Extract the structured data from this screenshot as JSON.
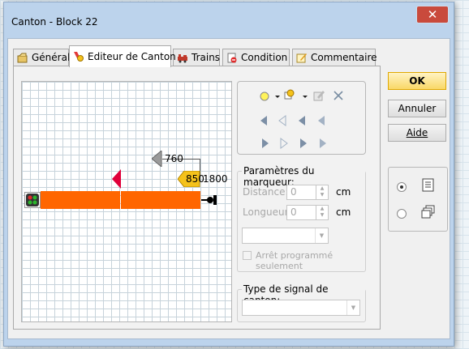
{
  "window": {
    "title": "Canton - Block 22"
  },
  "tabs": [
    {
      "label": "Général",
      "icon": "general-icon"
    },
    {
      "label": "Editeur de Canton",
      "icon": "editor-icon"
    },
    {
      "label": "Trains",
      "icon": "train-icon"
    },
    {
      "label": "Condition",
      "icon": "condition-icon"
    },
    {
      "label": "Commentaire",
      "icon": "comment-icon"
    }
  ],
  "editor": {
    "label_760": "760",
    "label_850": "850",
    "label_1800": "1800",
    "block_color": "#ff6600",
    "signal_color": "#e0003a",
    "marker_color": "#f5c21b"
  },
  "marker_params": {
    "legend": "Paramètres du marqueur:",
    "distance_label": "Distance:",
    "distance_value": "0",
    "distance_unit": "cm",
    "length_label": "Longueur:",
    "length_value": "0",
    "length_unit": "cm",
    "checkbox_label": "Arrêt programmé seulement"
  },
  "signal_type": {
    "legend": "Type de signal de canton:"
  },
  "buttons": {
    "ok": "OK",
    "cancel": "Annuler",
    "help": "Aide"
  }
}
